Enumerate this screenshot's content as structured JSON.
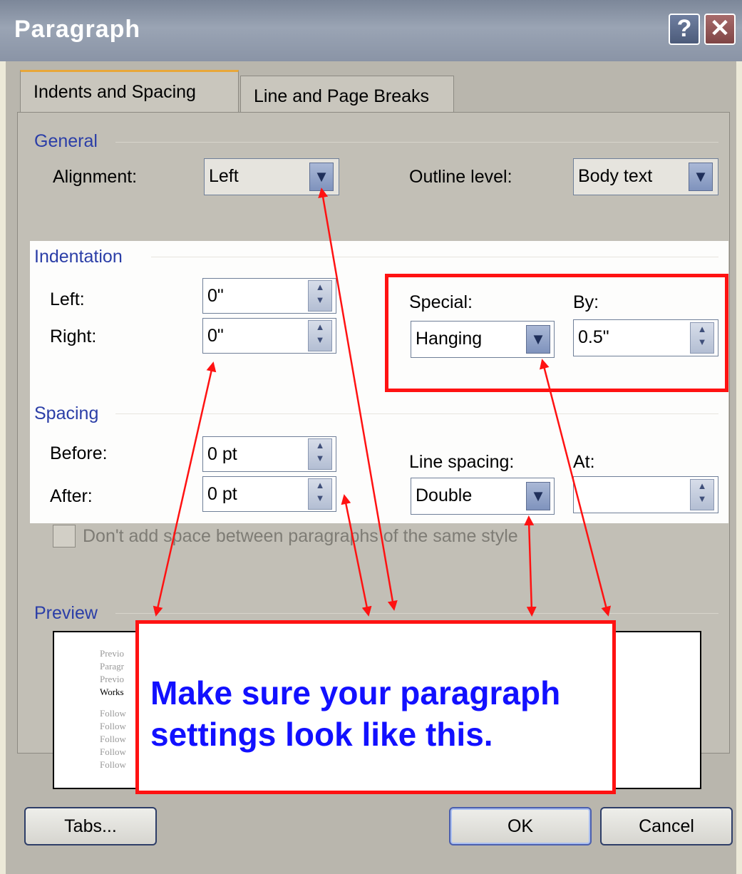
{
  "window": {
    "title": "Paragraph",
    "help_label": "?",
    "close_label": "✕"
  },
  "tabs": [
    {
      "label": "Indents and Spacing",
      "selected": true
    },
    {
      "label": "Line and Page Breaks",
      "selected": false
    }
  ],
  "general": {
    "group_label": "General",
    "alignment_label": "Alignment:",
    "alignment_value": "Left",
    "outline_label": "Outline level:",
    "outline_value": "Body text"
  },
  "indentation": {
    "group_label": "Indentation",
    "left_label": "Left:",
    "left_value": "0\"",
    "right_label": "Right:",
    "right_value": "0\"",
    "special_label": "Special:",
    "special_value": "Hanging",
    "by_label": "By:",
    "by_value": "0.5\""
  },
  "spacing": {
    "group_label": "Spacing",
    "before_label": "Before:",
    "before_value": "0 pt",
    "after_label": "After:",
    "after_value": "0 pt",
    "line_spacing_label": "Line spacing:",
    "line_spacing_value": "Double",
    "at_label": "At:",
    "at_value": ""
  },
  "checkbox": {
    "label": "Don't add space between paragraphs of the same style",
    "checked": false
  },
  "preview": {
    "group_label": "Preview",
    "lines": [
      "Previo",
      "Paragr",
      "Previo",
      "Works",
      "Follow",
      "Follow",
      "Follow",
      "Follow",
      "Follow"
    ]
  },
  "callout": {
    "line1": "Make sure your paragraph",
    "line2": "settings look like this."
  },
  "buttons": {
    "tabs_label": "Tabs...",
    "ok_label": "OK",
    "cancel_label": "Cancel"
  },
  "colors": {
    "annotation_red": "#ff1212",
    "callout_text": "#1210ff",
    "group_label": "#2b3ea7"
  }
}
